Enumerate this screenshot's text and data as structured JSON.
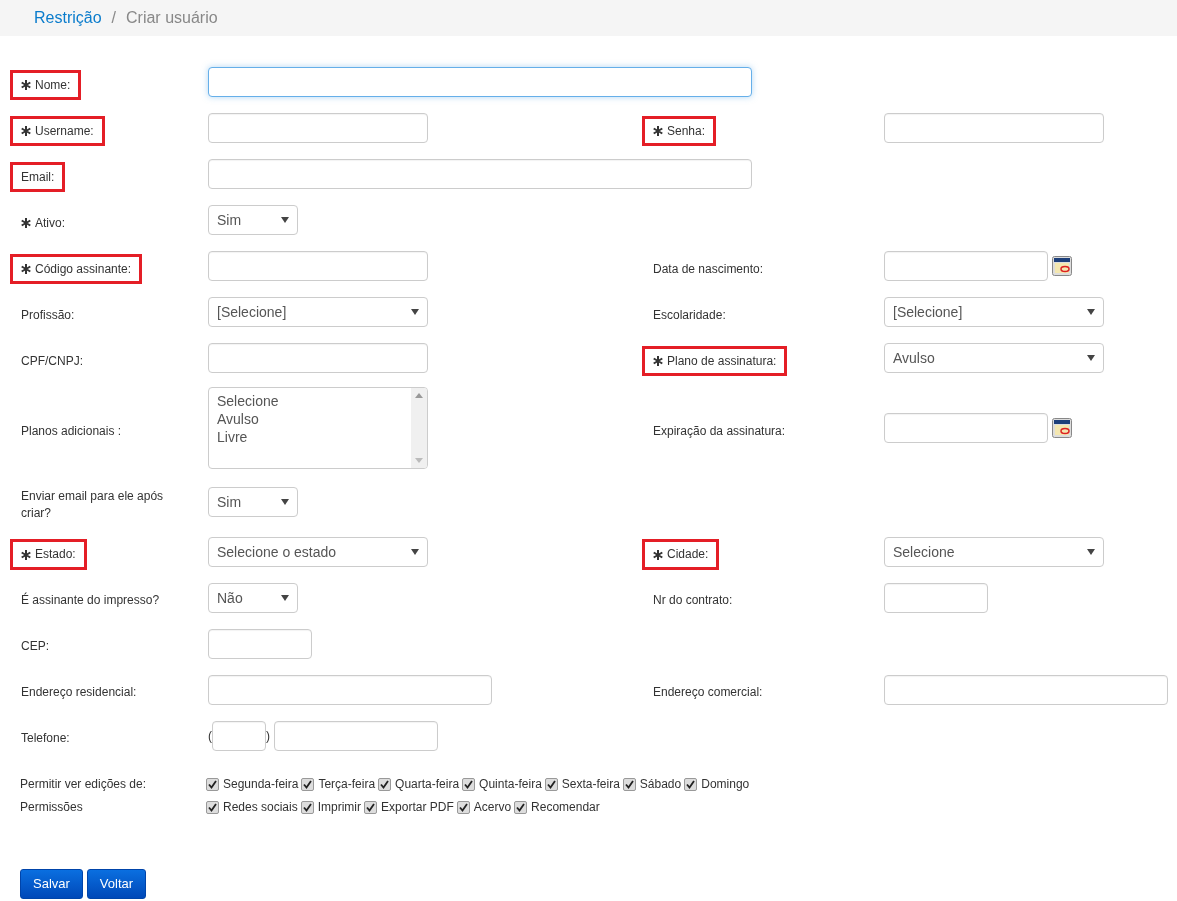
{
  "breadcrumb": {
    "parent": "Restrição",
    "separator": "/",
    "current": "Criar usuário"
  },
  "rows": [
    {
      "left": {
        "label": "Nome:",
        "required": true,
        "highlighted": true,
        "kind": "text-long",
        "focused": true
      }
    },
    {
      "left": {
        "label": "Username:",
        "required": true,
        "highlighted": true,
        "kind": "text"
      },
      "right": {
        "label": "Senha:",
        "required": true,
        "highlighted": true,
        "kind": "text"
      }
    },
    {
      "left": {
        "label": "Email:",
        "required": false,
        "highlighted": true,
        "kind": "text-long"
      }
    },
    {
      "left": {
        "label": "Ativo:",
        "required": true,
        "highlighted": false,
        "kind": "select-short",
        "value": "Sim"
      }
    },
    {
      "left": {
        "label": "Código assinante:",
        "required": true,
        "highlighted": true,
        "kind": "text"
      },
      "right": {
        "label": "Data de nascimento:",
        "required": false,
        "highlighted": false,
        "kind": "date"
      }
    },
    {
      "left": {
        "label": "Profissão:",
        "required": false,
        "highlighted": false,
        "kind": "select",
        "value": "[Selecione]"
      },
      "right": {
        "label": "Escolaridade:",
        "required": false,
        "highlighted": false,
        "kind": "select",
        "value": "[Selecione]"
      }
    },
    {
      "left": {
        "label": "CPF/CNPJ:",
        "required": false,
        "highlighted": false,
        "kind": "text"
      },
      "right": {
        "label": "Plano de assinatura:",
        "required": true,
        "highlighted": true,
        "kind": "select",
        "value": "Avulso"
      }
    },
    {
      "left": {
        "label": "Planos adicionais :",
        "required": false,
        "highlighted": false,
        "kind": "listbox",
        "options": [
          "Selecione",
          "Avulso",
          "Livre"
        ]
      },
      "right": {
        "label": "Expiração da assinatura:",
        "required": false,
        "highlighted": false,
        "kind": "date"
      }
    },
    {
      "left": {
        "label": "Enviar email para ele após criar?",
        "required": false,
        "highlighted": false,
        "kind": "select-short",
        "value": "Sim"
      }
    },
    {
      "left": {
        "label": "Estado:",
        "required": true,
        "highlighted": true,
        "kind": "select",
        "value": "Selecione o estado"
      },
      "right": {
        "label": "Cidade:",
        "required": true,
        "highlighted": true,
        "kind": "select",
        "value": "Selecione"
      }
    },
    {
      "left": {
        "label": "É assinante do impresso?",
        "required": false,
        "highlighted": false,
        "kind": "select-short",
        "value": "Não"
      },
      "right": {
        "label": "Nr do contrato:",
        "required": false,
        "highlighted": false,
        "kind": "text-short"
      }
    },
    {
      "left": {
        "label": "CEP:",
        "required": false,
        "highlighted": false,
        "kind": "text-short"
      }
    },
    {
      "left": {
        "label": "Endereço residencial:",
        "required": false,
        "highlighted": false,
        "kind": "text-mid"
      },
      "right": {
        "label": "Endereço comercial:",
        "required": false,
        "highlighted": false,
        "kind": "text-mid"
      }
    },
    {
      "left": {
        "label": "Telefone:",
        "required": false,
        "highlighted": false,
        "kind": "phone",
        "prefix": "(",
        "suffix": ")"
      }
    }
  ],
  "checkbox_groups": [
    {
      "label": "Permitir ver edições de:",
      "options": [
        {
          "label": "Segunda-feira",
          "checked": true
        },
        {
          "label": "Terça-feira",
          "checked": true
        },
        {
          "label": "Quarta-feira",
          "checked": true
        },
        {
          "label": "Quinta-feira",
          "checked": true
        },
        {
          "label": "Sexta-feira",
          "checked": true
        },
        {
          "label": "Sábado",
          "checked": true
        },
        {
          "label": "Domingo",
          "checked": true
        }
      ]
    },
    {
      "label": "Permissões",
      "options": [
        {
          "label": "Redes sociais",
          "checked": true
        },
        {
          "label": "Imprimir",
          "checked": true
        },
        {
          "label": "Exportar PDF",
          "checked": true
        },
        {
          "label": "Acervo",
          "checked": true
        },
        {
          "label": "Recomendar",
          "checked": true
        }
      ]
    }
  ],
  "buttons": [
    "Salvar",
    "Voltar"
  ]
}
